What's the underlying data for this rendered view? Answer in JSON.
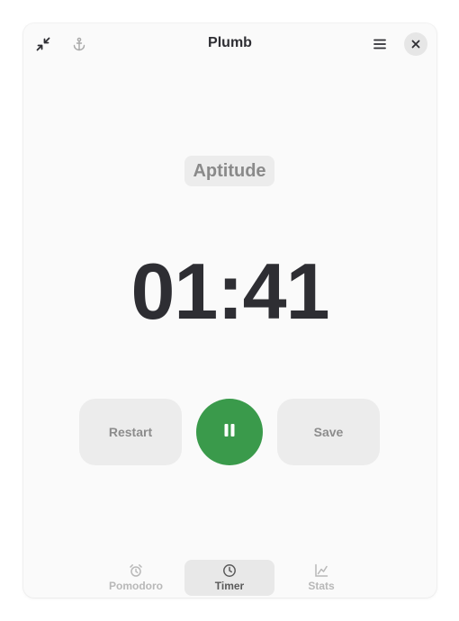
{
  "header": {
    "title": "Plumb",
    "icons": {
      "collapse": "collapse-arrows-icon",
      "anchor": "anchor-icon",
      "menu": "hamburger-menu-icon",
      "close": "close-icon"
    }
  },
  "session": {
    "tag": "Aptitude",
    "time": "01:41"
  },
  "controls": {
    "restart_label": "Restart",
    "save_label": "Save",
    "pause_icon": "pause-icon"
  },
  "nav": {
    "items": [
      {
        "label": "Pomodoro",
        "icon": "alarm-clock-icon",
        "active": false
      },
      {
        "label": "Timer",
        "icon": "clock-icon",
        "active": true
      },
      {
        "label": "Stats",
        "icon": "stats-chart-icon",
        "active": false
      }
    ]
  },
  "colors": {
    "accent_green": "#3a9a4b",
    "text_dark": "#2e2e33",
    "muted_text": "#8c8c8c",
    "button_bg": "#ececec"
  }
}
